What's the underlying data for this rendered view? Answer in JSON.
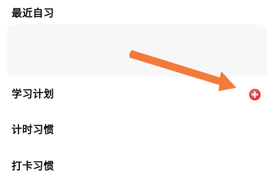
{
  "sections": {
    "recent": {
      "title": "最近自习"
    },
    "plan": {
      "title": "学习计划"
    },
    "timer_habit": {
      "title": "计时习惯"
    },
    "checkin_habit": {
      "title": "打卡习惯"
    }
  },
  "icons": {
    "add": "plus-circle-icon",
    "annotation": "arrow-icon"
  },
  "colors": {
    "add_button": "#e5333f",
    "annotation_arrow": "#f47a3c",
    "card_background": "#f7f7f7"
  }
}
